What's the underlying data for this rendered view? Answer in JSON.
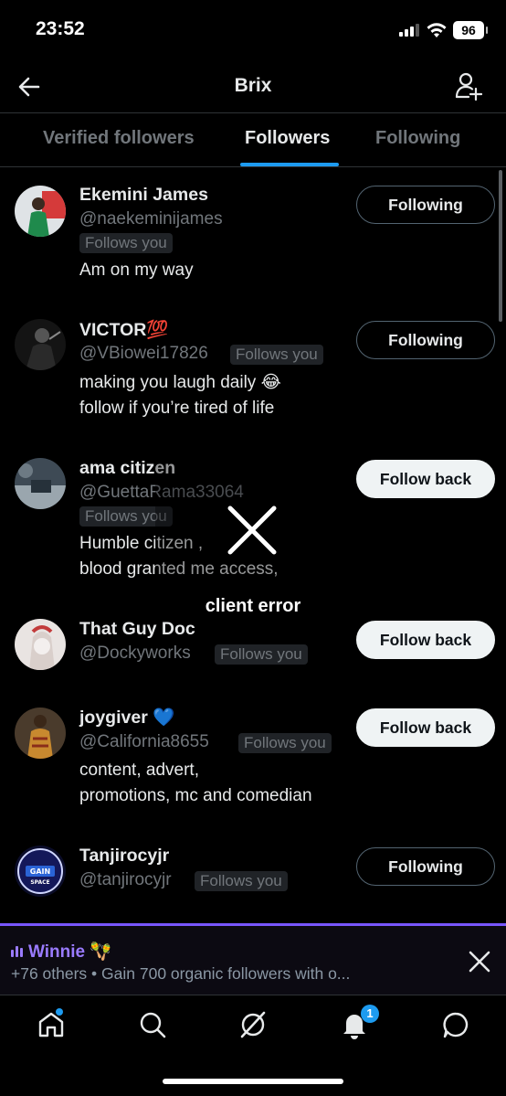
{
  "status_bar": {
    "time": "23:52",
    "battery": "96"
  },
  "header": {
    "title": "Brix"
  },
  "tabs": [
    {
      "label": "Verified followers"
    },
    {
      "label": "Followers"
    },
    {
      "label": "Following"
    }
  ],
  "followers": [
    {
      "name": "Ekemini James",
      "handle": "@naekeminijames",
      "badge": "Follows you",
      "bio": [
        "Am on my way"
      ],
      "button": "Following"
    },
    {
      "name": "VICTOR💯",
      "handle": "@VBiowei17826",
      "badge": "Follows you",
      "bio": [
        "making you laugh daily 😂",
        "follow if you’re tired of life"
      ],
      "button": "Following"
    },
    {
      "name": "ama citizen",
      "handle": "@GuettaRama33064",
      "badge": "Follows you",
      "bio": [
        "Humble citizen ,",
        "blood granted me access,"
      ],
      "button": "Follow back"
    },
    {
      "name": "That Guy Doc",
      "handle": "@Dockyworks",
      "badge": "Follows you",
      "bio": [],
      "button": "Follow back"
    },
    {
      "name": "joygiver 💙",
      "handle": "@California8655",
      "badge": "Follows you",
      "bio": [
        "content, advert,",
        "promotions, mc and comedian"
      ],
      "button": "Follow back"
    },
    {
      "name": "Tanjirocyjr",
      "handle": "@tanjirocyjr",
      "badge": "Follows you",
      "bio": [],
      "button": "Following"
    }
  ],
  "error_overlay": {
    "text": "client error"
  },
  "space": {
    "host": "Winnie 🪇",
    "subtitle": "+76 others • Gain 700 organic followers with o..."
  },
  "nav": {
    "notification_count": "1"
  },
  "colors": {
    "accent": "#1d9bf0",
    "space": "#7856ff"
  }
}
